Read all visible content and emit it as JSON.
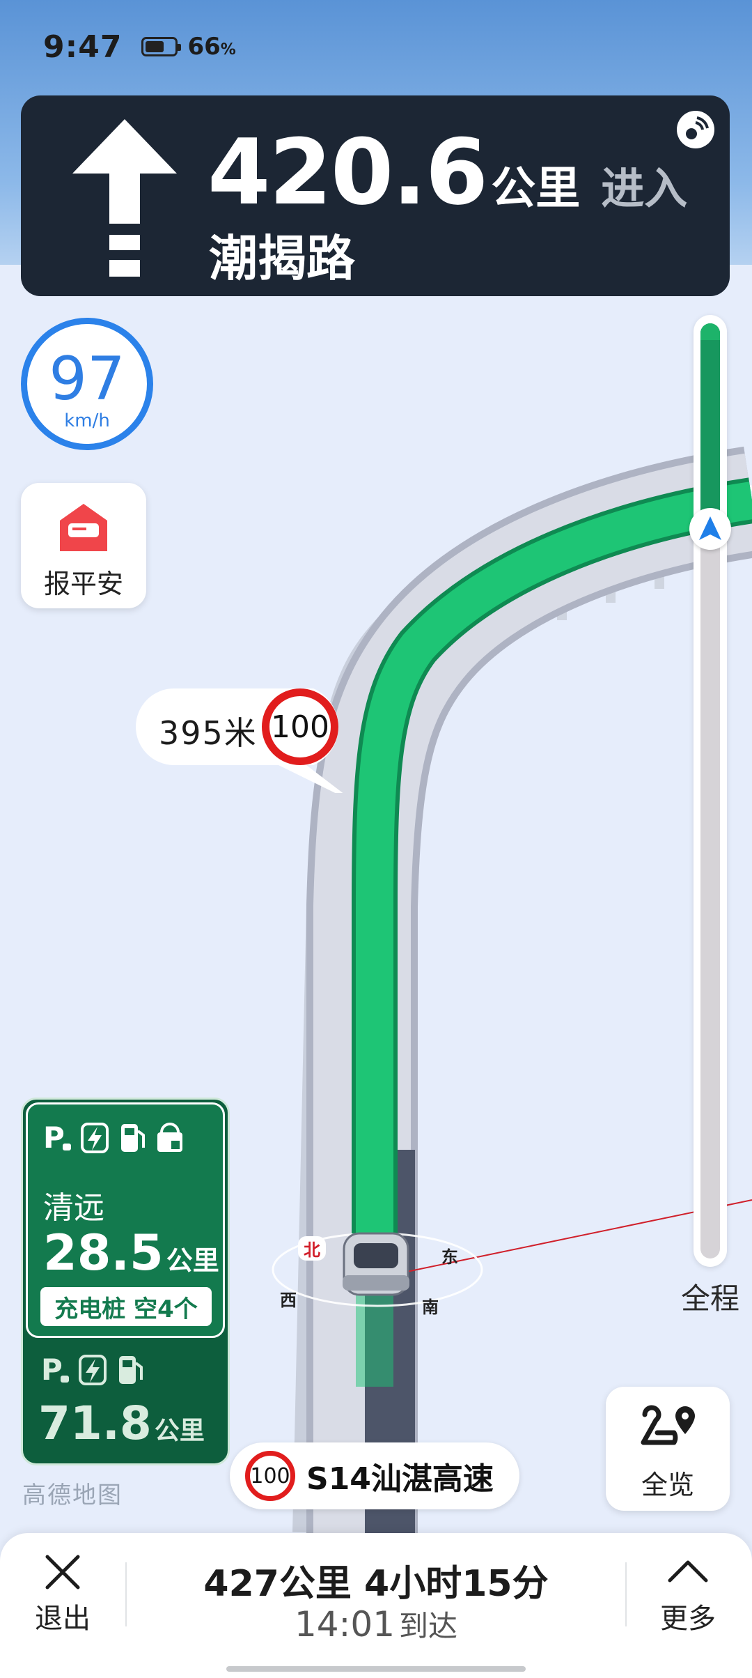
{
  "status_bar": {
    "time": "9:47",
    "battery_percent": "66",
    "battery_symbol": "%"
  },
  "maneuver": {
    "icon": "straight-arrow-icon",
    "distance_value": "420.6",
    "distance_unit": "公里",
    "action": "进入",
    "road_name": "潮揭路"
  },
  "current_speed": {
    "value": "97",
    "unit": "km/h"
  },
  "report_safe": {
    "icon": "envelope-icon",
    "label": "报平安"
  },
  "speed_camera": {
    "distance": "395米",
    "limit": "100"
  },
  "route_progress": {
    "completed_fraction": 0.22,
    "label": "全程"
  },
  "service_areas": [
    {
      "name": "清远",
      "distance": "28.5",
      "unit": "公里",
      "charger_status": "充电桩 空4个",
      "facilities": [
        "parking-icon",
        "charging-icon",
        "fuel-icon",
        "shop-icon"
      ]
    },
    {
      "name": "",
      "distance": "71.8",
      "unit": "公里",
      "facilities": [
        "parking-icon",
        "charging-icon",
        "fuel-icon"
      ]
    }
  ],
  "compass": {
    "north": "北",
    "east": "东",
    "south": "南",
    "west": "西"
  },
  "current_road": {
    "speed_limit": "100",
    "name": "S14汕湛高速"
  },
  "overview_button": {
    "icon": "route-overview-icon",
    "label": "全览"
  },
  "brand": "高德地图",
  "bottom_bar": {
    "exit_label": "退出",
    "remaining": "427公里 4小时15分",
    "arrival_time": "14:01",
    "arrival_label": "到达",
    "more_label": "更多"
  },
  "colors": {
    "route_green": "#1db36a",
    "nav_card": "#1c2634",
    "speed_blue": "#2b82ea",
    "limit_red": "#e11d1d",
    "service_green": "#137a4e"
  }
}
